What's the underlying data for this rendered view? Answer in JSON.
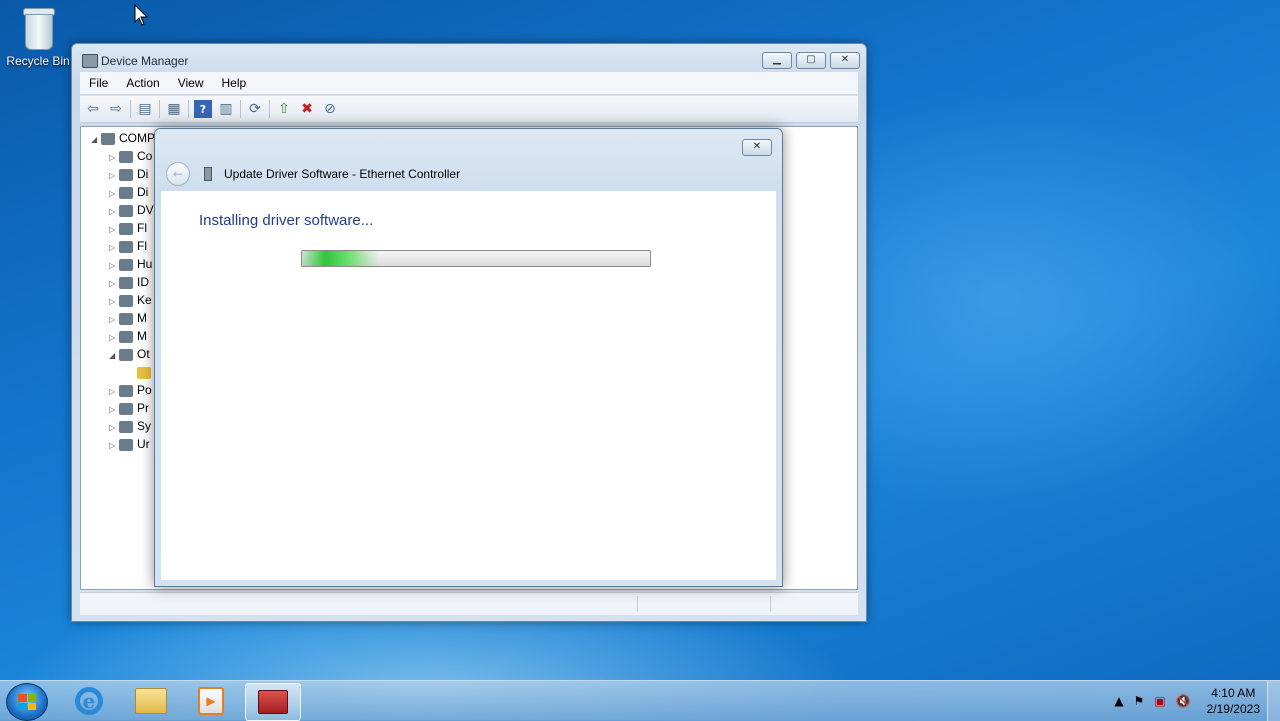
{
  "desktop": {
    "recycle_bin_label": "Recycle Bin"
  },
  "device_manager": {
    "title": "Device Manager",
    "menu": [
      "File",
      "Action",
      "View",
      "Help"
    ],
    "tree": [
      {
        "label": "COMP",
        "expander": "◢",
        "level": 0
      },
      {
        "label": "Co",
        "expander": "▷",
        "level": 1
      },
      {
        "label": "Di",
        "expander": "▷",
        "level": 1
      },
      {
        "label": "Di",
        "expander": "▷",
        "level": 1
      },
      {
        "label": "DV",
        "expander": "▷",
        "level": 1
      },
      {
        "label": "Fl",
        "expander": "▷",
        "level": 1
      },
      {
        "label": "Fl",
        "expander": "▷",
        "level": 1
      },
      {
        "label": "Hu",
        "expander": "▷",
        "level": 1
      },
      {
        "label": "ID",
        "expander": "▷",
        "level": 1
      },
      {
        "label": "Ke",
        "expander": "▷",
        "level": 1
      },
      {
        "label": "M",
        "expander": "▷",
        "level": 1
      },
      {
        "label": "M",
        "expander": "▷",
        "level": 1
      },
      {
        "label": "Ot",
        "expander": "◢",
        "level": 1
      },
      {
        "label": "",
        "expander": "",
        "level": 2
      },
      {
        "label": "Po",
        "expander": "▷",
        "level": 1
      },
      {
        "label": "Pr",
        "expander": "▷",
        "level": 1
      },
      {
        "label": "Sy",
        "expander": "▷",
        "level": 1
      },
      {
        "label": "Ur",
        "expander": "▷",
        "level": 1
      }
    ]
  },
  "dialog": {
    "title": "Update Driver Software - Ethernet Controller",
    "status_text": "Installing driver software...",
    "progress_fraction": 0.22,
    "close_glyph": "✕",
    "back_glyph": "←"
  },
  "taskbar": {
    "time": "4:10 AM",
    "date": "2/19/2023",
    "ie_glyph": "e",
    "media_glyph": "▶"
  },
  "colors": {
    "accent_text": "#1e3d8f",
    "progress_green": "#31c53d"
  }
}
